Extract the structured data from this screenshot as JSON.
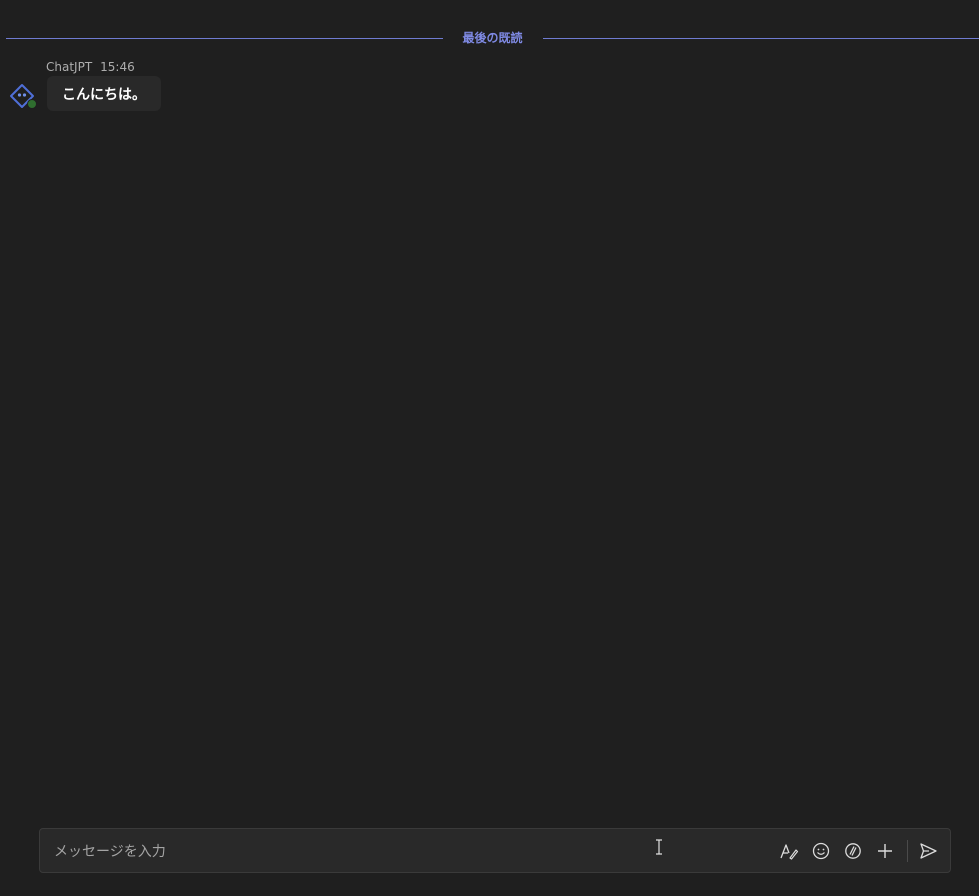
{
  "divider": {
    "label": "最後の既読"
  },
  "message": {
    "sender": "ChatJPT",
    "time": "15:46",
    "text": "こんにちは。",
    "avatar_icon": "bot-diamond-icon",
    "presence": "available"
  },
  "compose": {
    "placeholder": "メッセージを入力",
    "value": "",
    "tools": [
      {
        "icon": "format-icon"
      },
      {
        "icon": "emoji-icon"
      },
      {
        "icon": "loop-icon"
      },
      {
        "icon": "plus-icon"
      }
    ],
    "send_icon": "send-icon"
  },
  "colors": {
    "background": "#1f1f1f",
    "accent": "#7f8ae4",
    "bubble": "#292929",
    "presence_green": "#2f6e2f"
  }
}
